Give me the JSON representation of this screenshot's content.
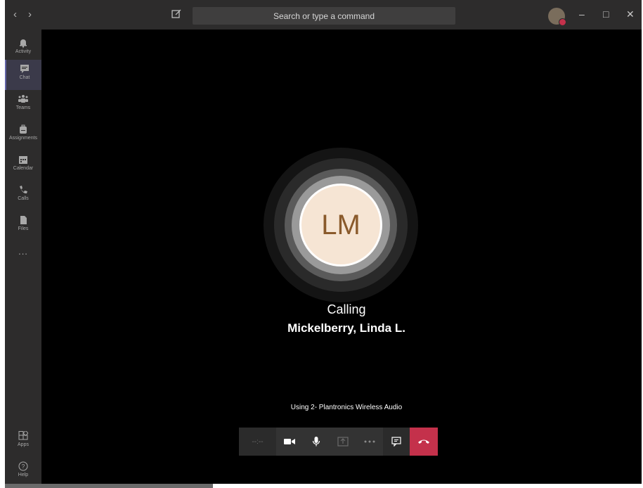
{
  "titlebar": {
    "back_icon": "chevron-left-icon",
    "forward_icon": "chevron-right-icon",
    "search_placeholder": "Search or type a command",
    "window_controls": [
      "minimize-icon",
      "maximize-icon",
      "close-icon"
    ]
  },
  "rail": {
    "items": [
      {
        "label": "Activity",
        "icon": "bell-icon"
      },
      {
        "label": "Chat",
        "icon": "chat-icon",
        "active": true
      },
      {
        "label": "Teams",
        "icon": "teams-icon"
      },
      {
        "label": "Assignments",
        "icon": "backpack-icon"
      },
      {
        "label": "Calendar",
        "icon": "calendar-icon"
      },
      {
        "label": "Calls",
        "icon": "phone-icon"
      },
      {
        "label": "Files",
        "icon": "file-icon"
      }
    ],
    "more": "...",
    "bottom": [
      {
        "label": "Apps",
        "icon": "apps-icon"
      },
      {
        "label": "Help",
        "icon": "help-icon"
      }
    ]
  },
  "call": {
    "initials": "LM",
    "status": "Calling",
    "name": "Mickelberry, Linda L.",
    "device": "Using 2- Plantronics Wireless Audio",
    "timer": "--:--"
  },
  "colors": {
    "accent": "#6264a7",
    "hangup": "#c4314b",
    "avatar_bg": "#f6e5d4",
    "avatar_text": "#8a5a2b"
  }
}
